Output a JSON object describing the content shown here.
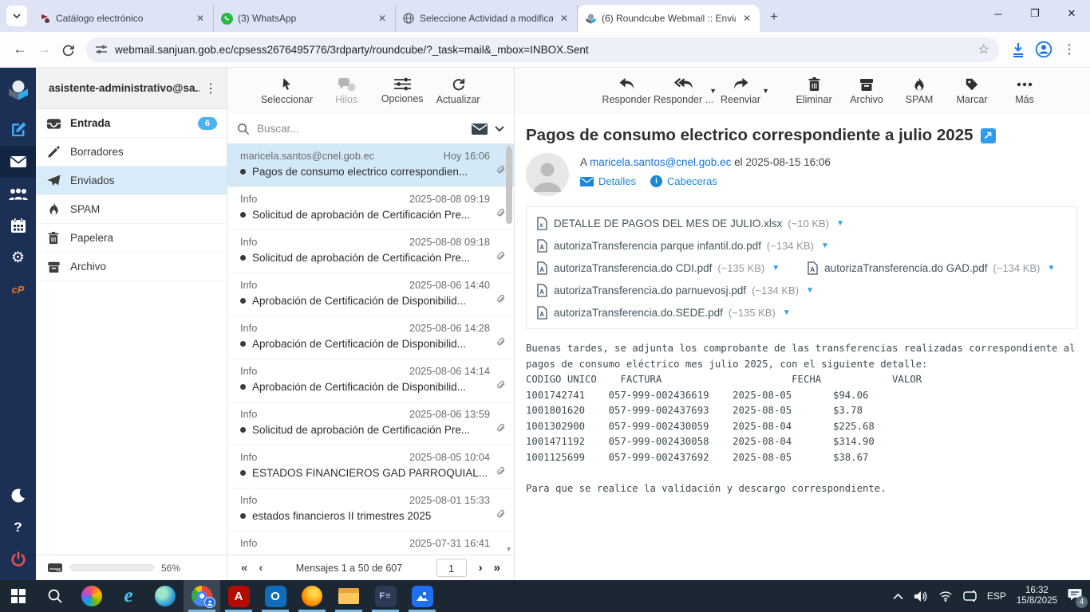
{
  "browser": {
    "tabs": [
      {
        "title": "Catálogo electrónico"
      },
      {
        "title": "(3) WhatsApp"
      },
      {
        "title": "Seleccione Actividad a modifica"
      },
      {
        "title": "(6) Roundcube Webmail :: Envia"
      }
    ],
    "url": "webmail.sanjuan.gob.ec/cpsess2676495776/3rdparty/roundcube/?_task=mail&_mbox=INBOX.Sent"
  },
  "account": {
    "email": "asistente-administrativo@sa..."
  },
  "folders": [
    {
      "label": "Entrada",
      "badge": "6"
    },
    {
      "label": "Borradores"
    },
    {
      "label": "Enviados"
    },
    {
      "label": "SPAM"
    },
    {
      "label": "Papelera"
    },
    {
      "label": "Archivo"
    }
  ],
  "quota": {
    "percent": "56%"
  },
  "list": {
    "toolbar_labels": [
      "Seleccionar",
      "Hilos",
      "Opciones",
      "Actualizar"
    ],
    "search_placeholder": "Buscar...",
    "messages": [
      {
        "sender": "maricela.santos@cnel.gob.ec",
        "date": "Hoy 16:06",
        "subject": "Pagos de consumo electrico correspondien..."
      },
      {
        "sender": "Info",
        "date": "2025-08-08 09:19",
        "subject": "Solicitud de aprobación de Certificación Pre..."
      },
      {
        "sender": "Info",
        "date": "2025-08-08 09:18",
        "subject": "Solicitud de aprobación de Certificación Pre..."
      },
      {
        "sender": "Info",
        "date": "2025-08-06 14:40",
        "subject": "Aprobación de Certificación de Disponibilid..."
      },
      {
        "sender": "Info",
        "date": "2025-08-06 14:28",
        "subject": "Aprobación de Certificación de Disponibilid..."
      },
      {
        "sender": "Info",
        "date": "2025-08-06 14:14",
        "subject": "Aprobación de Certificación de Disponibilid..."
      },
      {
        "sender": "Info",
        "date": "2025-08-06 13:59",
        "subject": "Solicitud de aprobación de Certificación Pre..."
      },
      {
        "sender": "Info",
        "date": "2025-08-05 10:04",
        "subject": "ESTADOS FINANCIEROS GAD PARROQUIAL..."
      },
      {
        "sender": "Info",
        "date": "2025-08-01 15:33",
        "subject": "estados financieros II trimestres 2025"
      },
      {
        "sender": "Info",
        "date": "2025-07-31 16:41",
        "subject": ""
      }
    ],
    "footer": {
      "count_text": "Mensajes 1 a 50 de 607",
      "page": "1"
    }
  },
  "mail": {
    "toolbar_labels": [
      "Responder",
      "Responder ...",
      "Reenviar",
      "Eliminar",
      "Archivo",
      "SPAM",
      "Marcar",
      "Más"
    ],
    "subject": "Pagos de consumo electrico correspondiente a julio 2025",
    "meta_prefix": "A",
    "from": "maricela.santos@cnel.gob.ec",
    "meta_suffix": "el 2025-08-15 16:06",
    "details_label": "Detalles",
    "headers_label": "Cabeceras",
    "attachments": [
      {
        "name": "DETALLE DE PAGOS DEL MES DE JULIO.xlsx",
        "size": "(~10 KB)",
        "ext": "x"
      },
      {
        "name": "autorizaTransferencia parque infantil.do.pdf",
        "size": "(~134 KB)",
        "ext": "A"
      },
      {
        "name": "autorizaTransferencia.do CDI.pdf",
        "size": "(~135 KB)",
        "ext": "A"
      },
      {
        "name": "autorizaTransferencia.do GAD.pdf",
        "size": "(~134 KB)",
        "ext": "A"
      },
      {
        "name": "autorizaTransferencia.do parnuevosj.pdf",
        "size": "(~134 KB)",
        "ext": "A"
      },
      {
        "name": "autorizaTransferencia.do.SEDE.pdf",
        "size": "(~135 KB)",
        "ext": "A"
      }
    ],
    "body": "Buenas tardes, se adjunta los comprobante de las transferencias realizadas correspondiente al\npagos de consumo eléctrico mes julio 2025, con el siguiente detalle:\nCODIGO UNICO    FACTURA                      FECHA            VALOR\n1001742741    057-999-002436619    2025-08-05       $94.06\n1001801620    057-999-002437693    2025-08-05       $3.78\n1001302900    057-999-002430059    2025-08-04       $225.68\n1001471192    057-999-002430058    2025-08-04       $314.90\n1001125699    057-999-002437692    2025-08-05       $38.67\n\nPara que se realice la validación y descargo correspondiente."
  },
  "taskbar": {
    "language": "ESP",
    "time": "16:32",
    "date": "15/8/2025",
    "notif_count": "4"
  },
  "colors": {
    "accent_blue": "#2e9af0",
    "rail_navy": "#1c2f55",
    "badge_blue": "#4cb1f3"
  }
}
